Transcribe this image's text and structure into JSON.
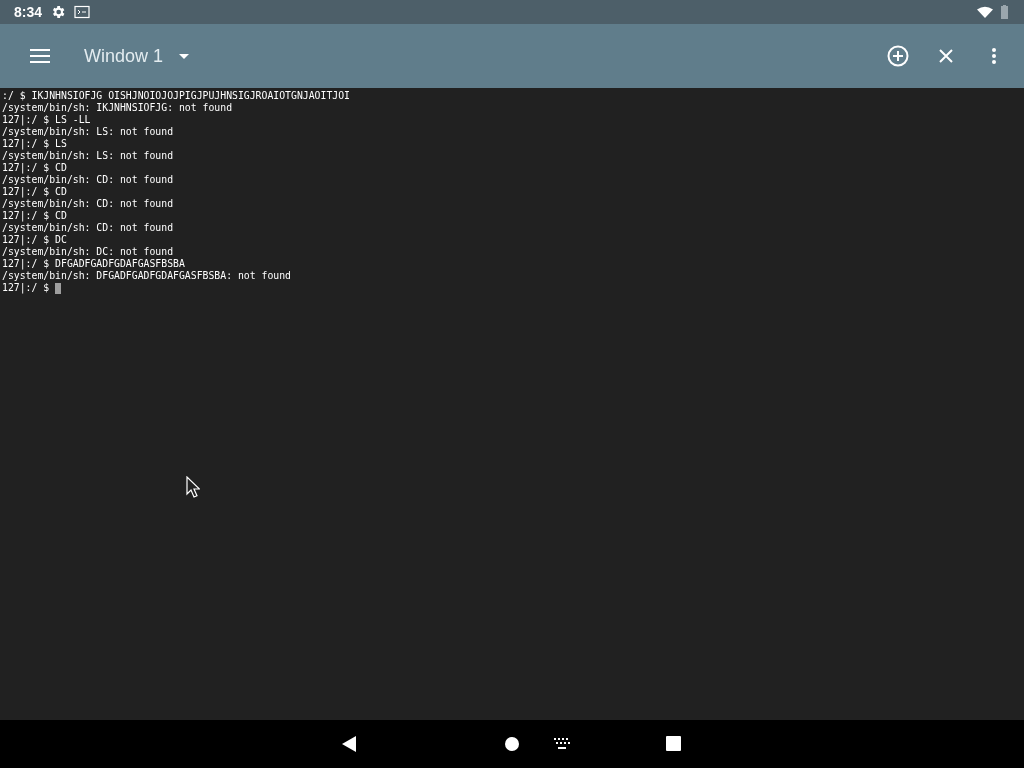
{
  "status_bar": {
    "time": "8:34"
  },
  "app_bar": {
    "title": "Window 1"
  },
  "terminal": {
    "lines": [
      ":/ $ IKJNHNSIOFJG OISHJNOIOJOJPIGJPUJHNSIGJROAIOTGNJAOITJOI",
      "/system/bin/sh: IKJNHNSIOFJG: not found",
      "127|:/ $ LS -LL",
      "/system/bin/sh: LS: not found",
      "127|:/ $ LS",
      "/system/bin/sh: LS: not found",
      "127|:/ $ CD",
      "/system/bin/sh: CD: not found",
      "127|:/ $ CD",
      "/system/bin/sh: CD: not found",
      "127|:/ $ CD",
      "/system/bin/sh: CD: not found",
      "127|:/ $ DC",
      "/system/bin/sh: DC: not found",
      "127|:/ $ DFGADFGADFGDAFGASFBSBA",
      "/system/bin/sh: DFGADFGADFGDAFGASFBSBA: not found"
    ],
    "prompt": "127|:/ $"
  }
}
